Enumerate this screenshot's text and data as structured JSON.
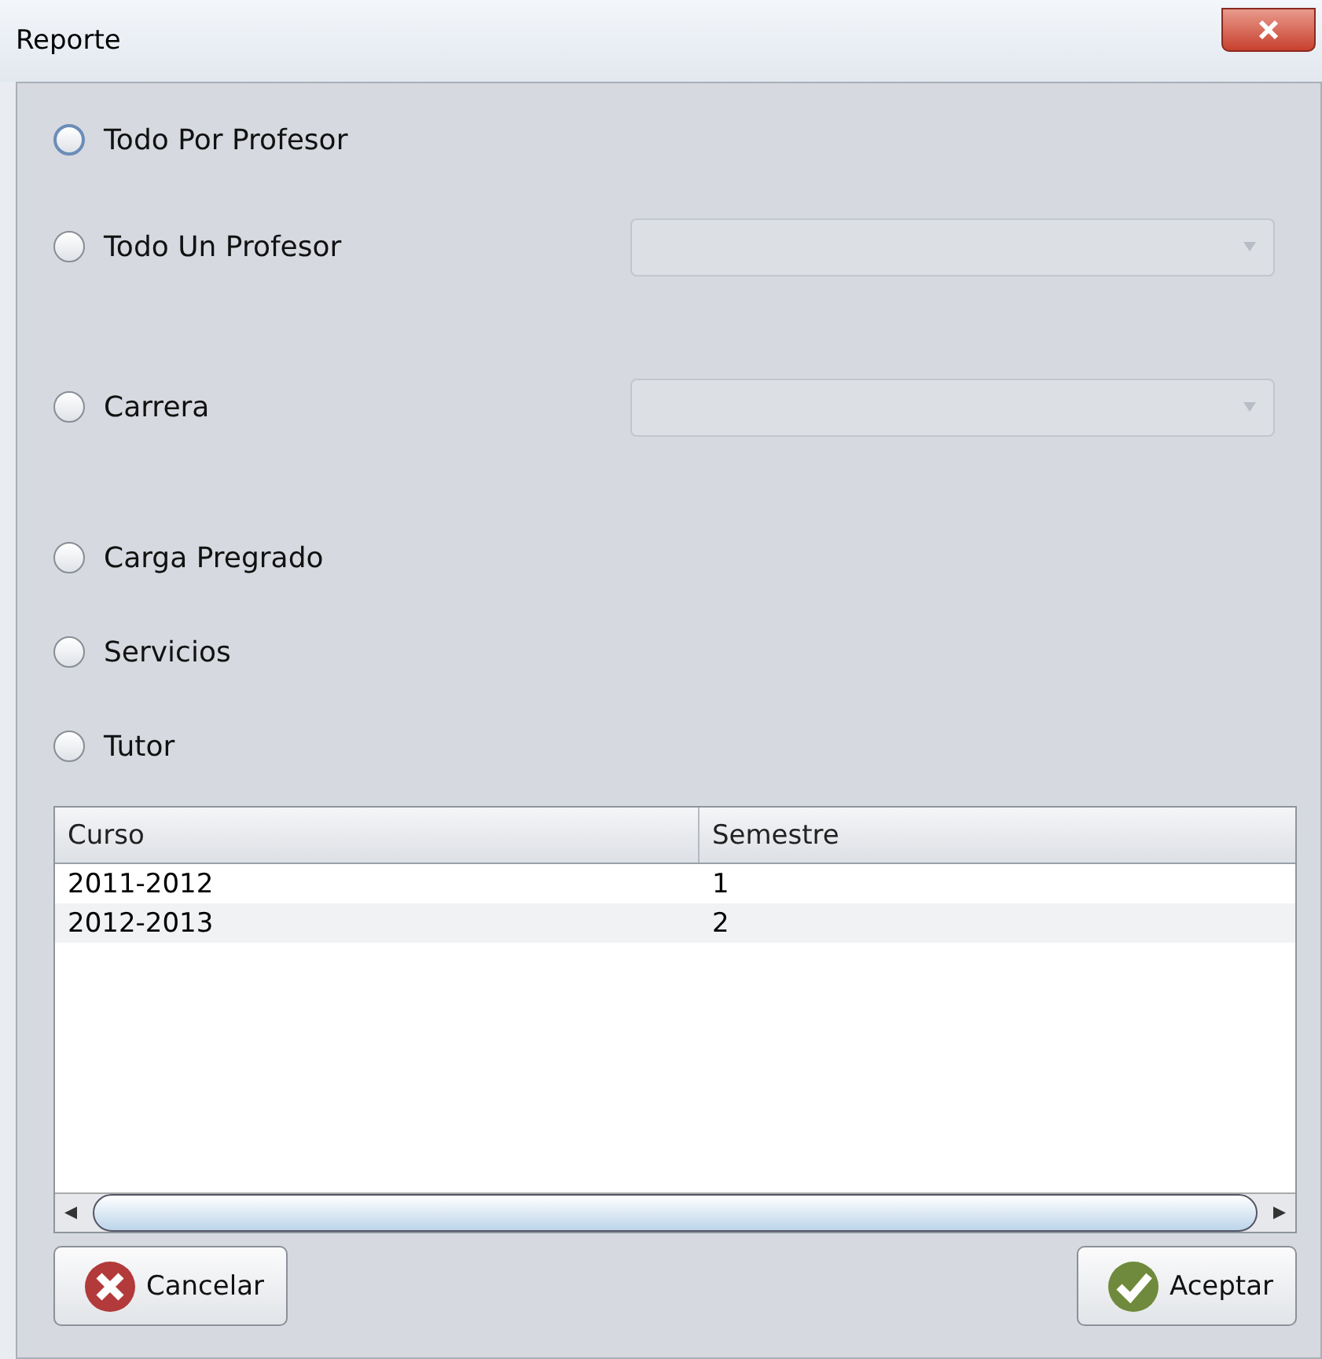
{
  "window": {
    "title": "Reporte"
  },
  "options": [
    {
      "label": "Todo Por Profesor",
      "kind": "plain",
      "selected": false,
      "focused": true
    },
    {
      "label": "Todo Un Profesor",
      "kind": "dropdown",
      "selected": false,
      "focused": false
    },
    {
      "label": "Carrera",
      "kind": "dropdown",
      "selected": false,
      "focused": false
    },
    {
      "label": "Carga Pregrado",
      "kind": "plain",
      "selected": false,
      "focused": false
    },
    {
      "label": "Servicios",
      "kind": "plain",
      "selected": false,
      "focused": false
    },
    {
      "label": "Tutor",
      "kind": "plain",
      "selected": false,
      "focused": false
    }
  ],
  "table": {
    "columns": [
      "Curso",
      "Semestre"
    ],
    "rows": [
      [
        "2011-2012",
        "1"
      ],
      [
        "2012-2013",
        "2"
      ]
    ]
  },
  "buttons": [
    {
      "label": "Cancelar",
      "kind": "cancel"
    },
    {
      "label": "Aceptar",
      "kind": "accept"
    }
  ]
}
